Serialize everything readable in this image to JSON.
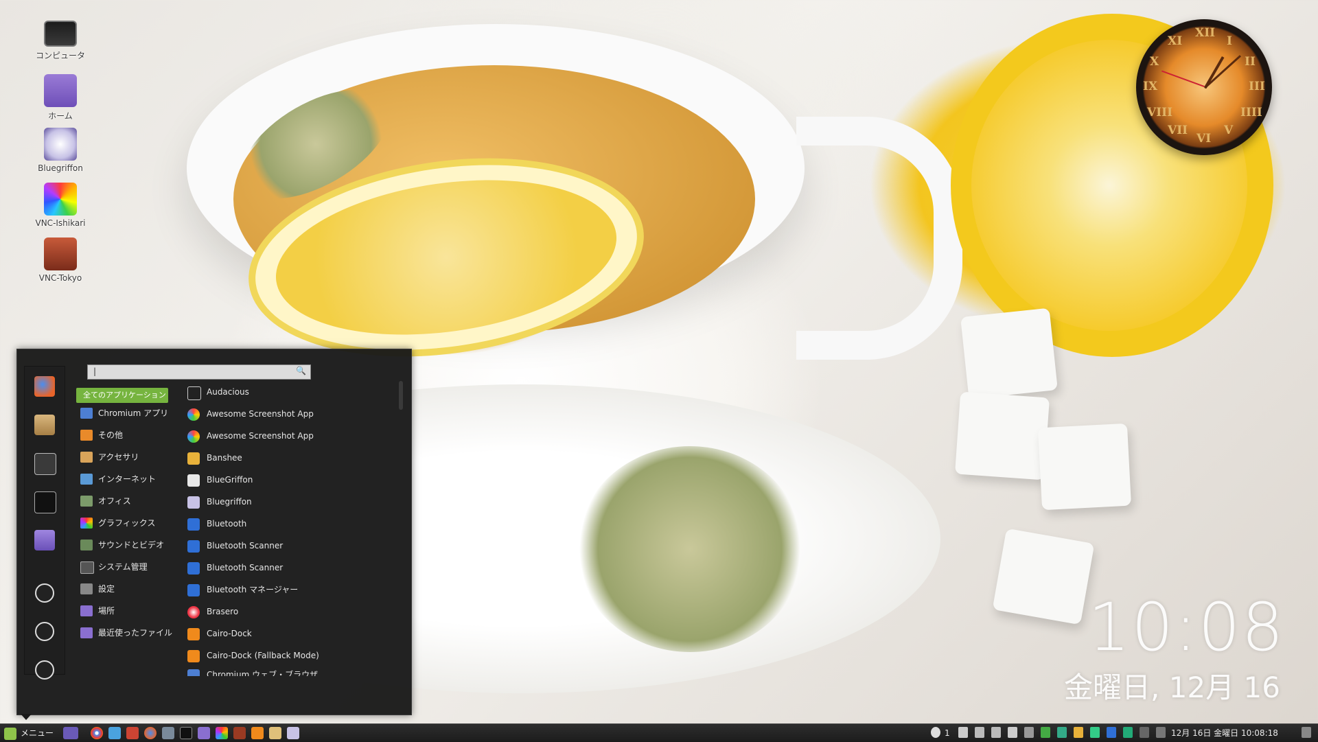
{
  "desktop_icons": [
    {
      "label": "コンピュータ",
      "icon": "computer-icon"
    },
    {
      "label": "ホーム",
      "icon": "home-folder-icon"
    },
    {
      "label": "Bluegriffon",
      "icon": "bluegriffon-icon"
    },
    {
      "label": "VNC-Ishikari",
      "icon": "vnc-ishikari-icon"
    },
    {
      "label": "VNC-Tokyo",
      "icon": "vnc-tokyo-icon"
    }
  ],
  "clock_widget": {
    "numerals": [
      "XII",
      "I",
      "II",
      "III",
      "IIII",
      "V",
      "VI",
      "VII",
      "VIII",
      "IX",
      "X",
      "XI"
    ]
  },
  "desktop_clock": {
    "time": "10:08",
    "date": "金曜日, 12月 16"
  },
  "menu": {
    "search": {
      "value": "|"
    },
    "favorites": [
      "firefox-icon",
      "package-icon",
      "settings-icon",
      "terminal-icon",
      "folder-icon",
      "lock-icon",
      "logout-icon",
      "shutdown-icon"
    ],
    "categories": [
      {
        "label": "全てのアプリケーション",
        "active": true
      },
      {
        "label": "Chromium アプリ"
      },
      {
        "label": "その他"
      },
      {
        "label": "アクセサリ"
      },
      {
        "label": "インターネット"
      },
      {
        "label": "オフィス"
      },
      {
        "label": "グラフィックス"
      },
      {
        "label": "サウンドとビデオ"
      },
      {
        "label": "システム管理"
      },
      {
        "label": "設定"
      },
      {
        "label": "場所"
      },
      {
        "label": "最近使ったファイル"
      }
    ],
    "apps": [
      {
        "label": "Audacious"
      },
      {
        "label": "Awesome Screenshot App"
      },
      {
        "label": "Awesome Screenshot App"
      },
      {
        "label": "Banshee"
      },
      {
        "label": "BlueGriffon"
      },
      {
        "label": "Bluegriffon"
      },
      {
        "label": "Bluetooth"
      },
      {
        "label": "Bluetooth Scanner"
      },
      {
        "label": "Bluetooth Scanner"
      },
      {
        "label": "Bluetooth マネージャー"
      },
      {
        "label": "Brasero"
      },
      {
        "label": "Cairo-Dock"
      },
      {
        "label": "Cairo-Dock (Fallback Mode)"
      },
      {
        "label": "Chromium ウェブ・ブラウザ"
      }
    ]
  },
  "taskbar": {
    "menu_label": "メニュー",
    "workspace_count": "1",
    "datetime": "12月 16日 金曜日 10:08:18"
  },
  "colors": {
    "menu_active": "#76b43f",
    "taskbar_bg": "#232323",
    "menu_bg": "#191919"
  }
}
